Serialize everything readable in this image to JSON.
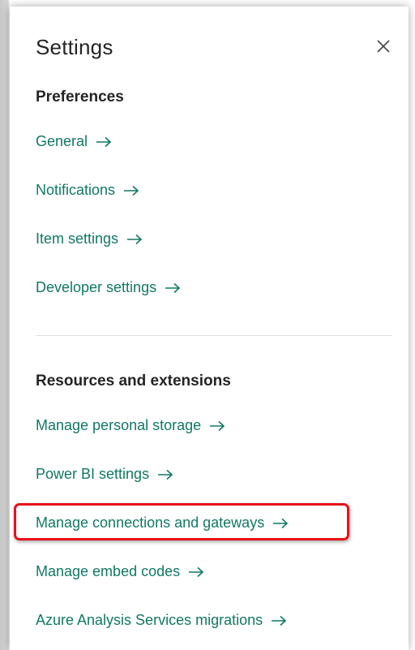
{
  "panel": {
    "title": "Settings",
    "close_icon": "close-icon"
  },
  "preferences": {
    "heading": "Preferences",
    "items": [
      {
        "label": "General",
        "icon": "arrow-right-icon"
      },
      {
        "label": "Notifications",
        "icon": "arrow-right-icon"
      },
      {
        "label": "Item settings",
        "icon": "arrow-right-icon"
      },
      {
        "label": "Developer settings",
        "icon": "arrow-right-icon"
      }
    ]
  },
  "resources": {
    "heading": "Resources and extensions",
    "items": [
      {
        "label": "Manage personal storage",
        "icon": "arrow-right-icon"
      },
      {
        "label": "Power BI settings",
        "icon": "arrow-right-icon"
      },
      {
        "label": "Manage connections and gateways",
        "icon": "arrow-right-icon",
        "highlighted": true
      },
      {
        "label": "Manage embed codes",
        "icon": "arrow-right-icon"
      },
      {
        "label": "Azure Analysis Services migrations",
        "icon": "arrow-right-icon"
      }
    ]
  },
  "colors": {
    "link": "#117865",
    "text": "#252423",
    "highlight_border": "#e8101a",
    "divider": "#e1dfdd"
  }
}
